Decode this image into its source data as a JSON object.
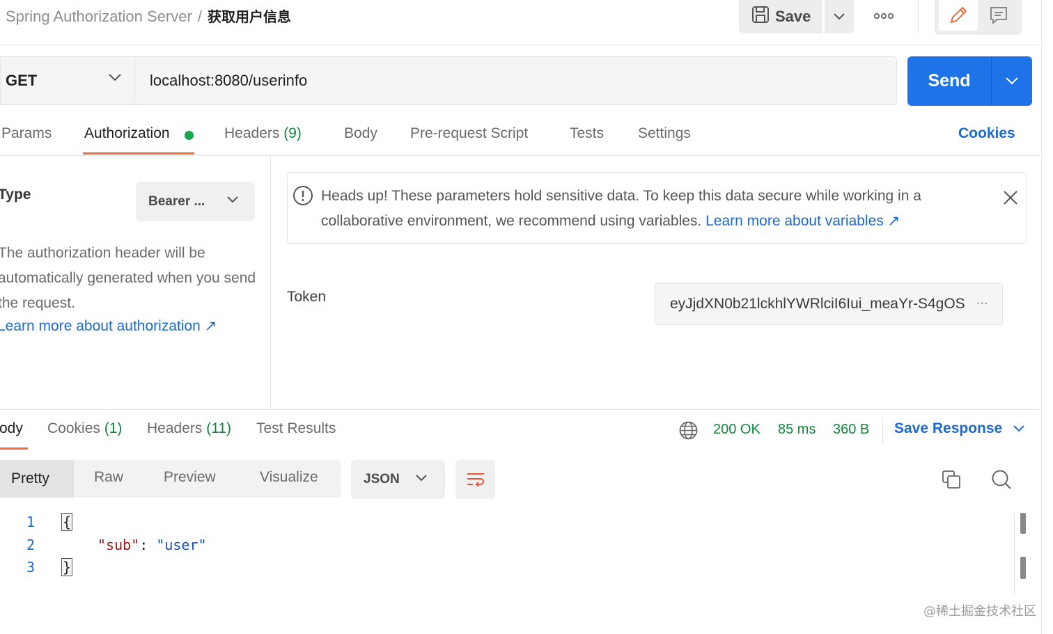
{
  "breadcrumb": {
    "parent": "Spring Authorization Server",
    "separator": "/",
    "current": "获取用户信息"
  },
  "toolbar": {
    "save_label": "Save"
  },
  "request": {
    "method": "GET",
    "url": "localhost:8080/userinfo",
    "send_label": "Send"
  },
  "request_tabs": {
    "params": "Params",
    "authorization": "Authorization",
    "headers": "Headers",
    "headers_count": "(9)",
    "body": "Body",
    "pre_request": "Pre-request Script",
    "tests": "Tests",
    "settings": "Settings",
    "cookies": "Cookies"
  },
  "auth": {
    "type_label": "Type",
    "type_value": "Bearer ...",
    "description": "The authorization header will be automatically generated when you send the request.",
    "learn_more": "Learn more about authorization ↗"
  },
  "notice": {
    "text": "Heads up! These parameters hold sensitive data. To keep this data secure while working in a collaborative environment, we recommend using variables.",
    "link": "Learn more about variables ↗"
  },
  "token": {
    "label": "Token",
    "value": "eyJjdXN0b21lckhlYWRlciI6Iui_meaYr-S4gOS",
    "ellipsis": "..."
  },
  "response_tabs": {
    "body": "Body",
    "cookies": "Cookies",
    "cookies_count": "(1)",
    "headers": "Headers",
    "headers_count": "(11)",
    "test_results": "Test Results"
  },
  "response_status": {
    "status": "200 OK",
    "time": "85 ms",
    "size": "360 B",
    "save_response": "Save Response"
  },
  "format": {
    "pretty": "Pretty",
    "raw": "Raw",
    "preview": "Preview",
    "visualize": "Visualize",
    "language": "JSON"
  },
  "code": {
    "line_numbers": [
      "1",
      "2",
      "3"
    ],
    "open_brace": "{",
    "key": "\"sub\"",
    "colon": ": ",
    "value": "\"user\"",
    "close_brace": "}"
  },
  "watermark": "@稀土掘金技术社区",
  "colors": {
    "accent": "#1f73e8",
    "active_tab": "#f26b3a",
    "success": "#0c8a3b",
    "link": "#1b69d4"
  }
}
